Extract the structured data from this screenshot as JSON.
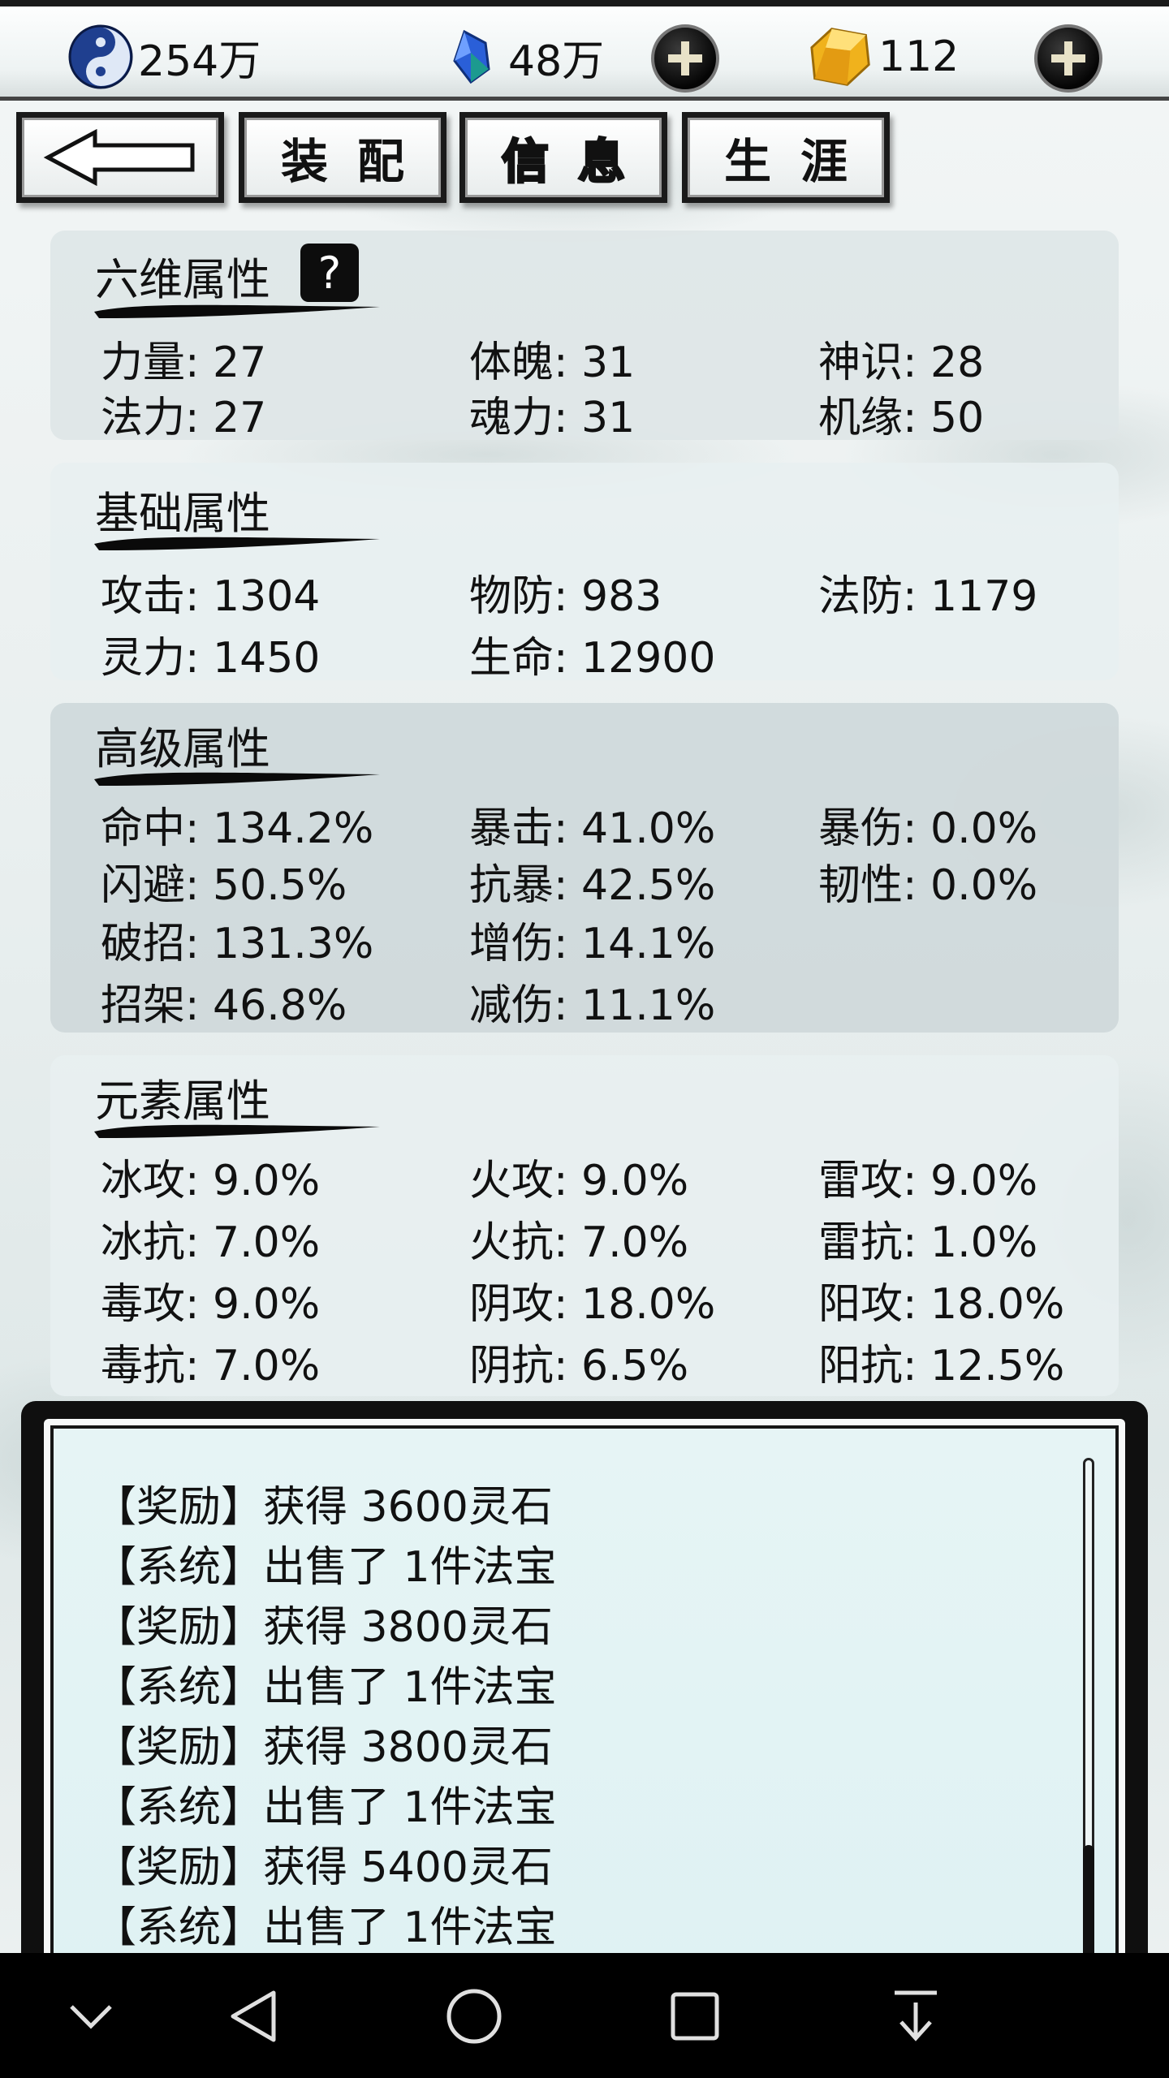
{
  "currencies": [
    {
      "icon": "yin-yang-icon",
      "value": "254万"
    },
    {
      "icon": "spirit-crystal-icon",
      "value": "48万"
    },
    {
      "icon": "gold-ingot-icon",
      "value": "112"
    }
  ],
  "tabs": [
    {
      "label": "",
      "icon": "back-arrow-icon"
    },
    {
      "label": "装配"
    },
    {
      "label": "信息",
      "active": true
    },
    {
      "label": "生涯"
    }
  ],
  "panels": {
    "six": {
      "title": "六维属性",
      "help": "?",
      "rows": [
        [
          "力量: 27",
          "体魄: 31",
          "神识: 28"
        ],
        [
          "法力: 27",
          "魂力: 31",
          "机缘: 50"
        ]
      ]
    },
    "base": {
      "title": "基础属性",
      "rows": [
        [
          "攻击: 1304",
          "物防: 983",
          "法防: 1179"
        ],
        [
          "灵力: 1450",
          "生命: 12900",
          ""
        ]
      ]
    },
    "adv": {
      "title": "高级属性",
      "rows": [
        [
          "命中: 134.2%",
          "暴击: 41.0%",
          "暴伤: 0.0%"
        ],
        [
          "闪避: 50.5%",
          "抗暴: 42.5%",
          "韧性: 0.0%"
        ],
        [
          "破招: 131.3%",
          "增伤: 14.1%",
          ""
        ],
        [
          "招架: 46.8%",
          "减伤: 11.1%",
          ""
        ]
      ]
    },
    "elem": {
      "title": "元素属性",
      "rows": [
        [
          "冰攻: 9.0%",
          "火攻: 9.0%",
          "雷攻: 9.0%"
        ],
        [
          "冰抗: 7.0%",
          "火抗: 7.0%",
          "雷抗: 1.0%"
        ],
        [
          "毒攻: 9.0%",
          "阴攻: 18.0%",
          "阳攻: 18.0%"
        ],
        [
          "毒抗: 7.0%",
          "阴抗: 6.5%",
          "阳抗: 12.5%"
        ]
      ]
    }
  },
  "log": [
    "【奖励】获得 3600灵石",
    "【系统】出售了 1件法宝",
    "【奖励】获得 3800灵石",
    "【系统】出售了 1件法宝",
    "【奖励】获得 3800灵石",
    "【系统】出售了 1件法宝",
    "【奖励】获得 5400灵石",
    "【系统】出售了 1件法宝"
  ],
  "navbar": [
    "chevron-down-icon",
    "back-triangle-icon",
    "home-circle-icon",
    "recents-square-icon",
    "download-icon"
  ],
  "colors": {
    "active_tab": "#f1d300",
    "frame": "#0f0f0f",
    "log_bg": "#e2f3f4"
  }
}
